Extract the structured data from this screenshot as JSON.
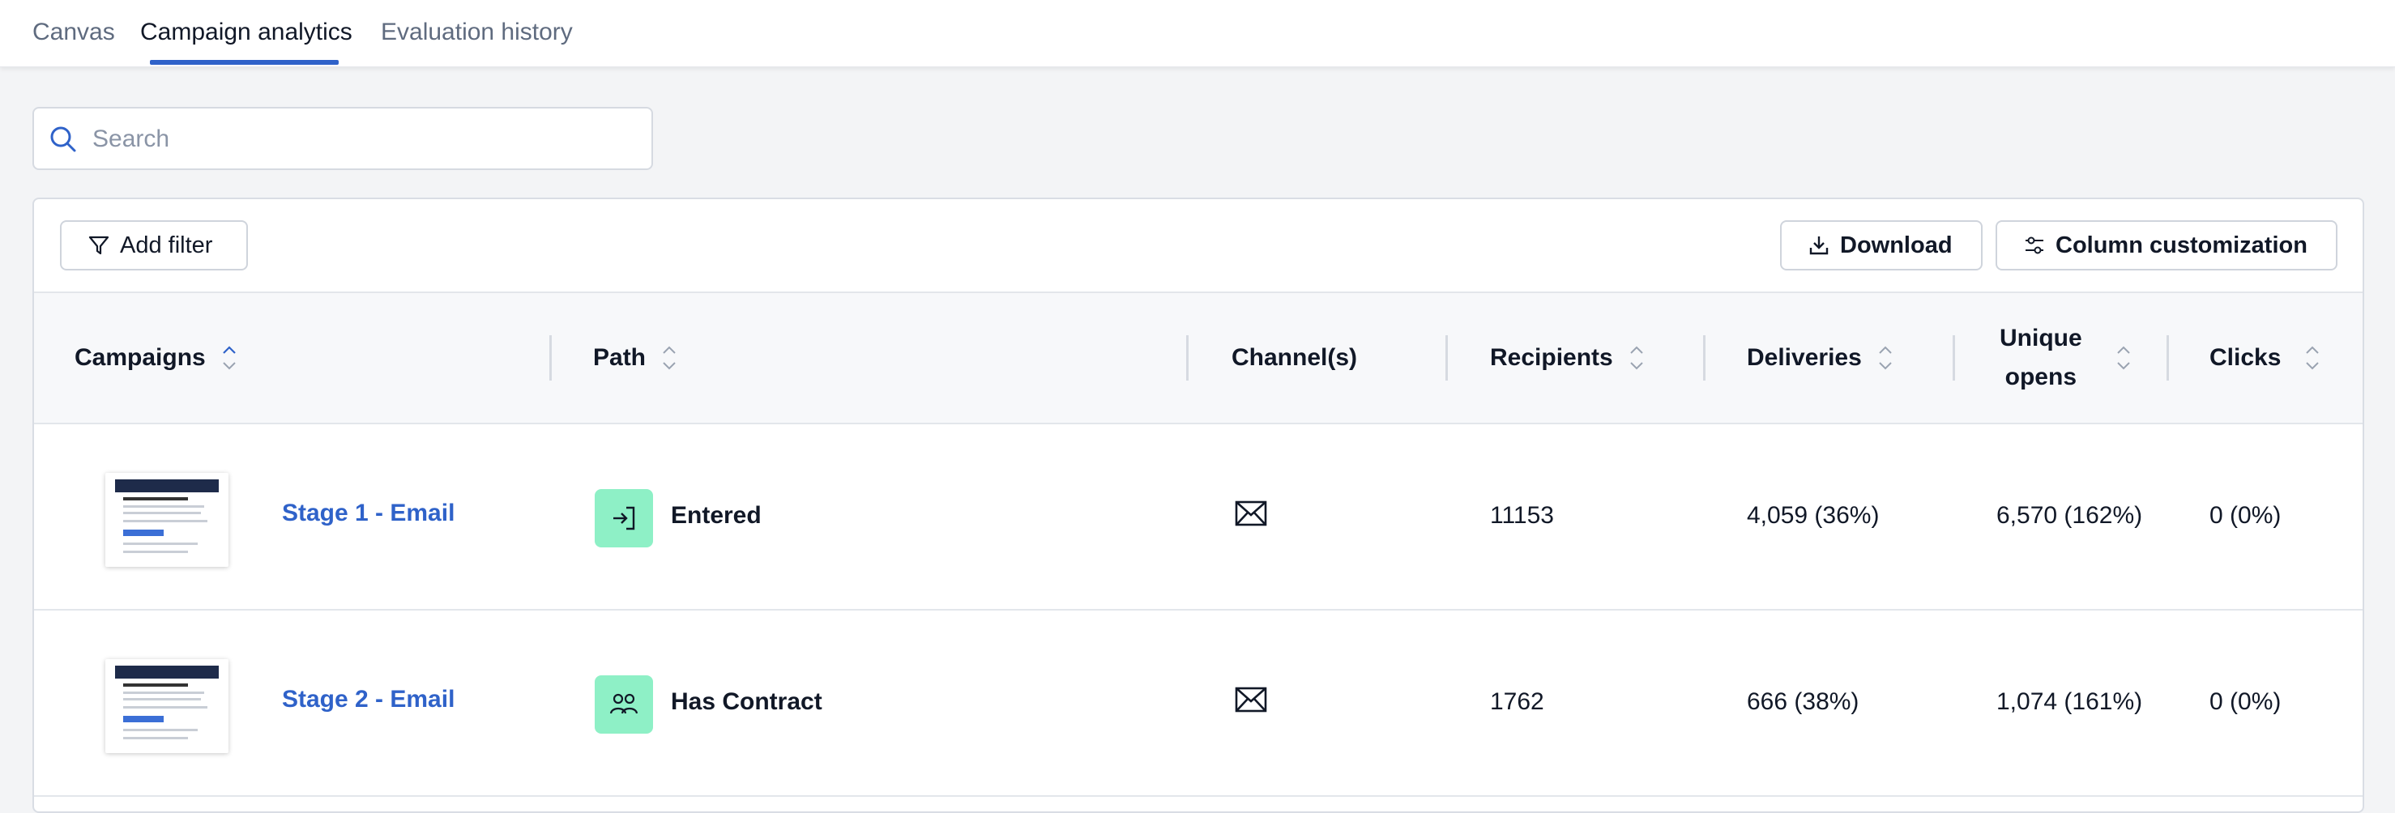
{
  "tabs": [
    {
      "label": "Canvas",
      "active": false
    },
    {
      "label": "Campaign analytics",
      "active": true
    },
    {
      "label": "Evaluation history",
      "active": false
    }
  ],
  "search": {
    "placeholder": "Search",
    "value": ""
  },
  "toolbar": {
    "add_filter_label": "Add filter",
    "download_label": "Download",
    "column_customization_label": "Column customization"
  },
  "table": {
    "columns": [
      "Campaigns",
      "Path",
      "Channel(s)",
      "Recipients",
      "Deliveries",
      "Unique opens",
      "Clicks"
    ],
    "unique_opens_line1": "Unique",
    "unique_opens_line2": "opens",
    "rows": [
      {
        "campaign": "Stage 1 - Email",
        "path": "Entered",
        "path_icon": "enter-icon",
        "channel_icon": "envelope-icon",
        "recipients": "11153",
        "deliveries": "4,059 (36%)",
        "unique_opens": "6,570 (162%)",
        "clicks": "0 (0%)"
      },
      {
        "campaign": "Stage 2 - Email",
        "path": "Has Contract",
        "path_icon": "people-icon",
        "channel_icon": "envelope-icon",
        "recipients": "1762",
        "deliveries": "666 (38%)",
        "unique_opens": "1,074 (161%)",
        "clicks": "0 (0%)"
      }
    ]
  },
  "colors": {
    "accent": "#2f62c9",
    "path_badge": "#8ef0c6",
    "background": "#f3f4f6"
  }
}
